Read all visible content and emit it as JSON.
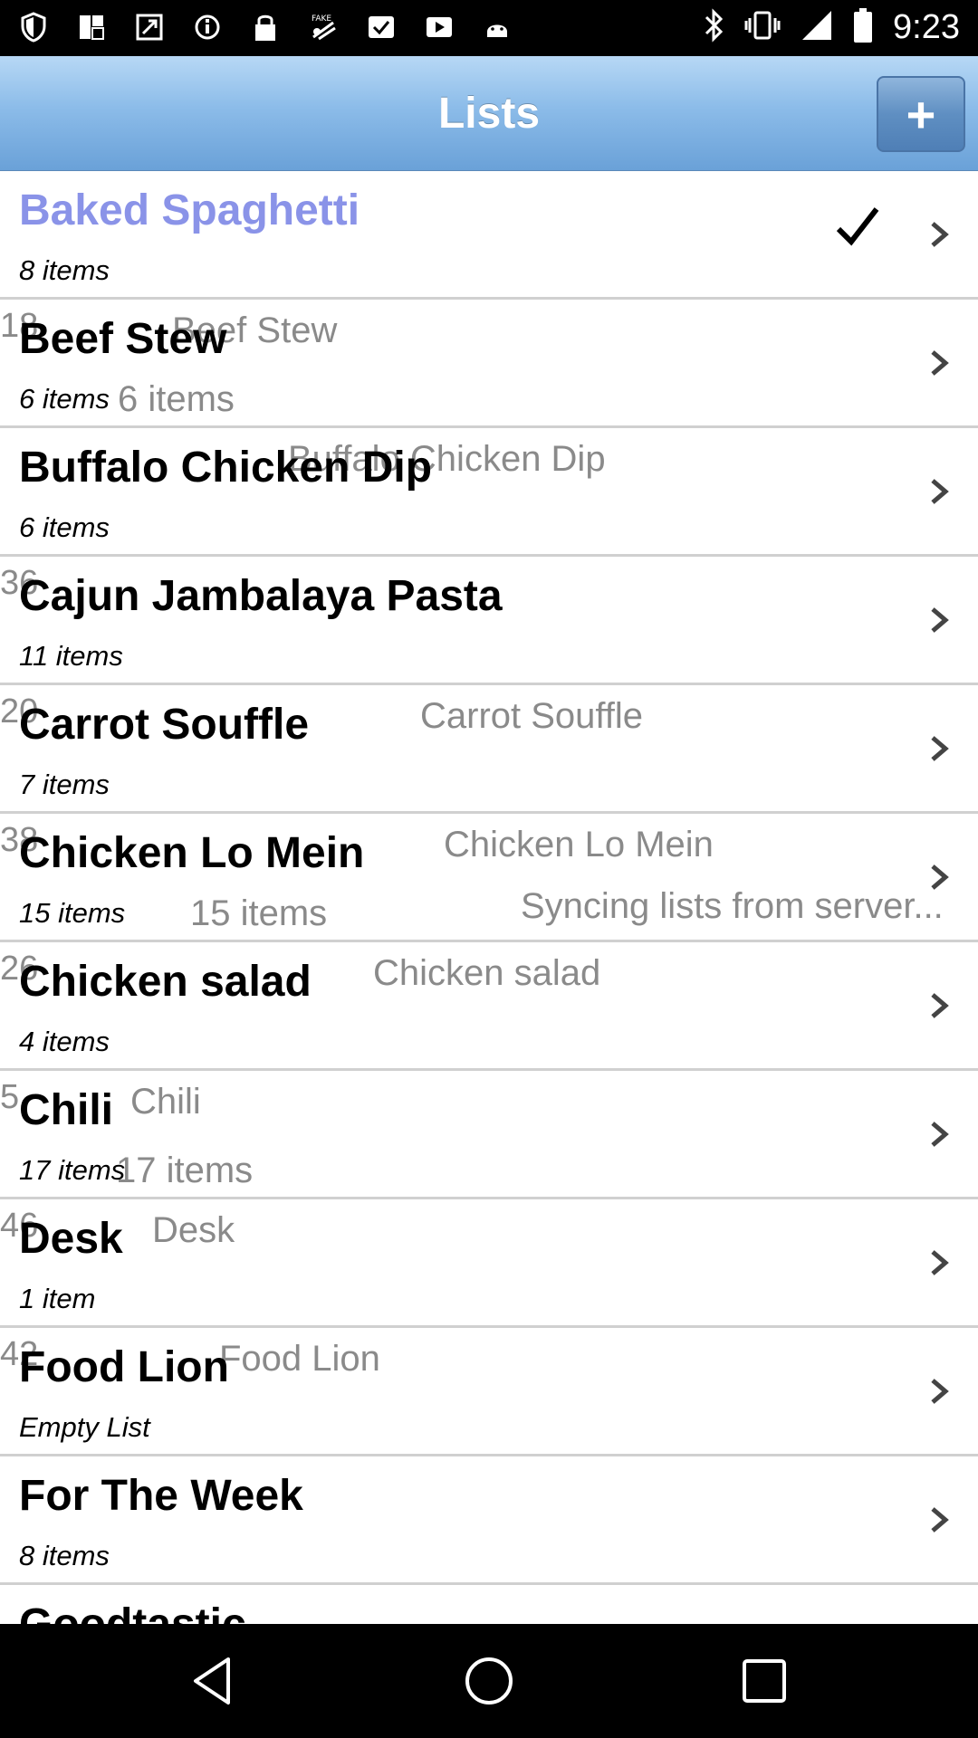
{
  "status_bar": {
    "time": "9:23",
    "left_icons": [
      "shield-icon",
      "flipboard-icon",
      "resize-icon",
      "info-icon",
      "lock-icon",
      "fake-gps-icon",
      "check-icon",
      "play-icon",
      "android-icon"
    ],
    "right_icons": [
      "bluetooth-icon",
      "vibrate-icon",
      "signal-icon",
      "battery-icon"
    ]
  },
  "header": {
    "title": "Lists",
    "add_label": "+"
  },
  "lists": [
    {
      "name": "Baked Spaghetti",
      "count": "8 items",
      "selected": true
    },
    {
      "name": "Beef Stew",
      "count": "6 items"
    },
    {
      "name": "Buffalo Chicken Dip",
      "count": "6 items"
    },
    {
      "name": "Cajun Jambalaya Pasta",
      "count": "11 items"
    },
    {
      "name": "Carrot Souffle",
      "count": "7 items"
    },
    {
      "name": "Chicken Lo Mein",
      "count": "15 items"
    },
    {
      "name": "Chicken salad",
      "count": "4 items"
    },
    {
      "name": "Chili",
      "count": "17 items"
    },
    {
      "name": "Desk",
      "count": "1 item"
    },
    {
      "name": "Food Lion",
      "count": "Empty List"
    },
    {
      "name": "For The Week",
      "count": "8 items"
    },
    {
      "name": "Goodtastic",
      "count": ""
    }
  ],
  "overlay": {
    "numbers": [
      "18",
      "36",
      "20",
      "38",
      "26",
      "5",
      "46",
      "42"
    ],
    "names": [
      "Beef Stew",
      "Buffalo Chicken Dip",
      "Carrot Souffle",
      "Chicken Lo Mein",
      "Chicken salad",
      "Chili",
      "Desk",
      "Food Lion"
    ],
    "counts": [
      "6 items",
      "15 items",
      "17 items"
    ],
    "sync_message": "Syncing lists from server..."
  },
  "colors": {
    "header_top": "#b7d8f5",
    "header_bottom": "#6aa1d8",
    "selected_text": "#8a93e8",
    "ghost_text": "#8a8a8a",
    "divider": "#d0d0d0"
  },
  "nav": [
    "back-icon",
    "home-icon",
    "recents-icon"
  ]
}
